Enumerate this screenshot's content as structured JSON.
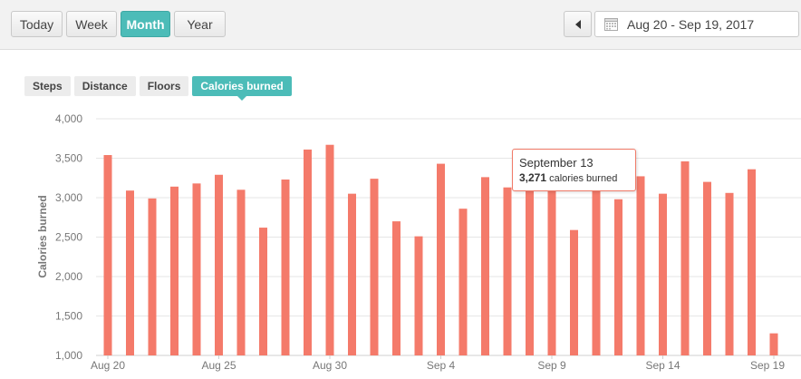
{
  "toolbar": {
    "periods": [
      {
        "label": "Today"
      },
      {
        "label": "Week"
      },
      {
        "label": "Month",
        "active": true
      },
      {
        "label": "Year"
      }
    ],
    "date_range": "Aug 20 - Sep 19, 2017"
  },
  "metric_tabs": [
    {
      "label": "Steps"
    },
    {
      "label": "Distance"
    },
    {
      "label": "Floors"
    },
    {
      "label": "Calories burned",
      "active": true
    }
  ],
  "tooltip": {
    "date": "September 13",
    "value": "3,271",
    "unit": "calories burned"
  },
  "colors": {
    "accent": "#4cbcb8",
    "bar": "#f47a6a",
    "grid": "#e6e6e6"
  },
  "chart_data": {
    "type": "bar",
    "ylabel": "Calories burned",
    "ylim": [
      1000,
      4000
    ],
    "yticks": [
      "1,000",
      "1,500",
      "2,000",
      "2,500",
      "3,000",
      "3,500",
      "4,000"
    ],
    "xtick_labels": [
      {
        "index": 0,
        "label": "Aug 20"
      },
      {
        "index": 5,
        "label": "Aug 25"
      },
      {
        "index": 10,
        "label": "Aug 30"
      },
      {
        "index": 15,
        "label": "Sep 4"
      },
      {
        "index": 20,
        "label": "Sep 9"
      },
      {
        "index": 25,
        "label": "Sep 14"
      },
      {
        "index": 30,
        "label": "Sep 19"
      }
    ],
    "values": [
      3540,
      3090,
      2990,
      3140,
      3180,
      3290,
      3100,
      2620,
      3230,
      3610,
      3670,
      3050,
      3240,
      2700,
      2510,
      3430,
      2860,
      3260,
      3130,
      3120,
      3330,
      2590,
      3470,
      2980,
      3271,
      3050,
      3460,
      3200,
      3060,
      3360,
      1280
    ]
  }
}
